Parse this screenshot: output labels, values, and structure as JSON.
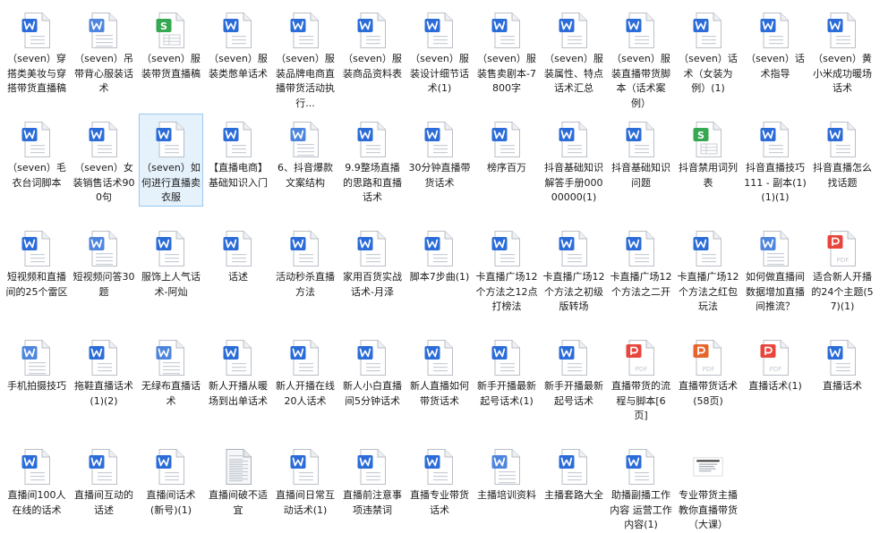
{
  "window": {
    "view": "large-icons",
    "selected_index": 15
  },
  "icon_colors": {
    "word": "#2b6cd8",
    "wps": "#36a852",
    "pdf": "#e8463c",
    "ppt": "#e5652d"
  },
  "files": [
    {
      "label": "（seven）穿搭类美妆与穿搭带货直播稿",
      "icon": "word-doc-icon"
    },
    {
      "label": "（seven）吊带背心服装话术",
      "icon": "doc-page-icon"
    },
    {
      "label": "（seven）服装带货直播稿",
      "icon": "wps-spreadsheet-icon"
    },
    {
      "label": "（seven）服装类憋单话术",
      "icon": "word-doc-icon"
    },
    {
      "label": "（seven）服装品牌电商直播带货活动执行...",
      "icon": "word-doc-icon"
    },
    {
      "label": "（seven）服装商品资料表",
      "icon": "word-doc-icon"
    },
    {
      "label": "（seven）服装设计细节话术(1)",
      "icon": "word-doc-icon"
    },
    {
      "label": "（seven）服装售卖剧本-7800字",
      "icon": "word-doc-icon"
    },
    {
      "label": "（seven）服装属性、特点话术汇总",
      "icon": "word-doc-icon"
    },
    {
      "label": "（seven）服装直播带货脚本（话术案例）",
      "icon": "word-doc-icon"
    },
    {
      "label": "（seven）话术（女装为例）(1)",
      "icon": "word-doc-icon"
    },
    {
      "label": "（seven）话术指导",
      "icon": "word-doc-icon"
    },
    {
      "label": "（seven）黄小米成功暖场话术",
      "icon": "word-doc-icon"
    },
    {
      "label": "（seven）毛衣台词脚本",
      "icon": "word-doc-icon"
    },
    {
      "label": "（seven）女装销售话术900句",
      "icon": "word-doc-icon"
    },
    {
      "label": "（seven）如何进行直播卖衣服",
      "icon": "word-doc-icon"
    },
    {
      "label": "【直播电商】基础知识入门",
      "icon": "word-doc-icon"
    },
    {
      "label": "6、抖音爆款文案结构",
      "icon": "doc-page-icon"
    },
    {
      "label": "9.9整场直播的思路和直播话术",
      "icon": "word-doc-icon"
    },
    {
      "label": "30分钟直播带货话术",
      "icon": "word-doc-icon"
    },
    {
      "label": "榜序百万",
      "icon": "word-doc-icon"
    },
    {
      "label": "抖音基础知识解答手册00000000(1)",
      "icon": "word-doc-icon"
    },
    {
      "label": "抖音基础知识问题",
      "icon": "word-doc-icon"
    },
    {
      "label": "抖音禁用词列表",
      "icon": "wps-spreadsheet-icon"
    },
    {
      "label": "抖音直播技巧111 - 副本(1)(1)(1)",
      "icon": "word-doc-icon"
    },
    {
      "label": "抖音直播怎么找话题",
      "icon": "word-doc-icon"
    },
    {
      "label": "短视频和直播间的25个雷区",
      "icon": "word-doc-icon"
    },
    {
      "label": "短视频问答30题",
      "icon": "doc-page-icon"
    },
    {
      "label": "服饰上人气话术-阿灿",
      "icon": "word-doc-icon"
    },
    {
      "label": "话述",
      "icon": "word-doc-icon"
    },
    {
      "label": "活动秒杀直播方法",
      "icon": "word-doc-icon"
    },
    {
      "label": "家用百货实战话术-月泽",
      "icon": "word-doc-icon"
    },
    {
      "label": "脚本7步曲(1)",
      "icon": "word-doc-icon"
    },
    {
      "label": "卡直播广场12个方法之12点打榜法",
      "icon": "word-doc-icon"
    },
    {
      "label": "卡直播广场12个方法之初级版转场",
      "icon": "word-doc-icon"
    },
    {
      "label": "卡直播广场12个方法之二开",
      "icon": "word-doc-icon"
    },
    {
      "label": "卡直播广场12个方法之红包玩法",
      "icon": "word-doc-icon"
    },
    {
      "label": "如何做直播间数据增加直播间推流？",
      "icon": "doc-page-icon"
    },
    {
      "label": "适合新人开播的24个主题(57)(1)",
      "icon": "pdf-icon"
    },
    {
      "label": "手机拍摄技巧",
      "icon": "doc-page-icon"
    },
    {
      "label": "拖鞋直播话术(1)(2)",
      "icon": "word-doc-icon"
    },
    {
      "label": "无绿布直播话术",
      "icon": "doc-page-icon"
    },
    {
      "label": "新人开播从暖场到出单话术",
      "icon": "word-doc-icon"
    },
    {
      "label": "新人开播在线20人话术",
      "icon": "word-doc-icon"
    },
    {
      "label": "新人小白直播间5分钟话术",
      "icon": "word-doc-icon"
    },
    {
      "label": "新人直播如何带货话术",
      "icon": "word-doc-icon"
    },
    {
      "label": "新手开播最新起号话术(1)",
      "icon": "word-doc-icon"
    },
    {
      "label": "新手开播最新起号话术",
      "icon": "word-doc-icon"
    },
    {
      "label": "直播带货的流程与脚本[6页]",
      "icon": "pdf-icon"
    },
    {
      "label": "直播带货话术(58页)",
      "icon": "ppt-icon"
    },
    {
      "label": "直播话术(1)",
      "icon": "pdf-icon"
    },
    {
      "label": "直播话术",
      "icon": "word-doc-icon"
    },
    {
      "label": "直播间100人在线的话术",
      "icon": "word-doc-icon"
    },
    {
      "label": "直播间互动的话述",
      "icon": "word-doc-icon"
    },
    {
      "label": "直播间话术(新号)(1)",
      "icon": "word-doc-icon"
    },
    {
      "label": "直播间破不适宜",
      "icon": "text-file-icon"
    },
    {
      "label": "直播间日常互动话术(1)",
      "icon": "word-doc-icon"
    },
    {
      "label": "直播前注意事项违禁词",
      "icon": "word-doc-icon"
    },
    {
      "label": "直播专业带货话术",
      "icon": "word-doc-icon"
    },
    {
      "label": "主播培训资料",
      "icon": "doc-page-icon"
    },
    {
      "label": "主播套路大全",
      "icon": "word-doc-icon"
    },
    {
      "label": "助播副播工作内容 运营工作内容(1)",
      "icon": "word-doc-icon"
    },
    {
      "label": "专业带货主播教你直播带货（大课）",
      "icon": "thumbnail-image-icon"
    }
  ]
}
